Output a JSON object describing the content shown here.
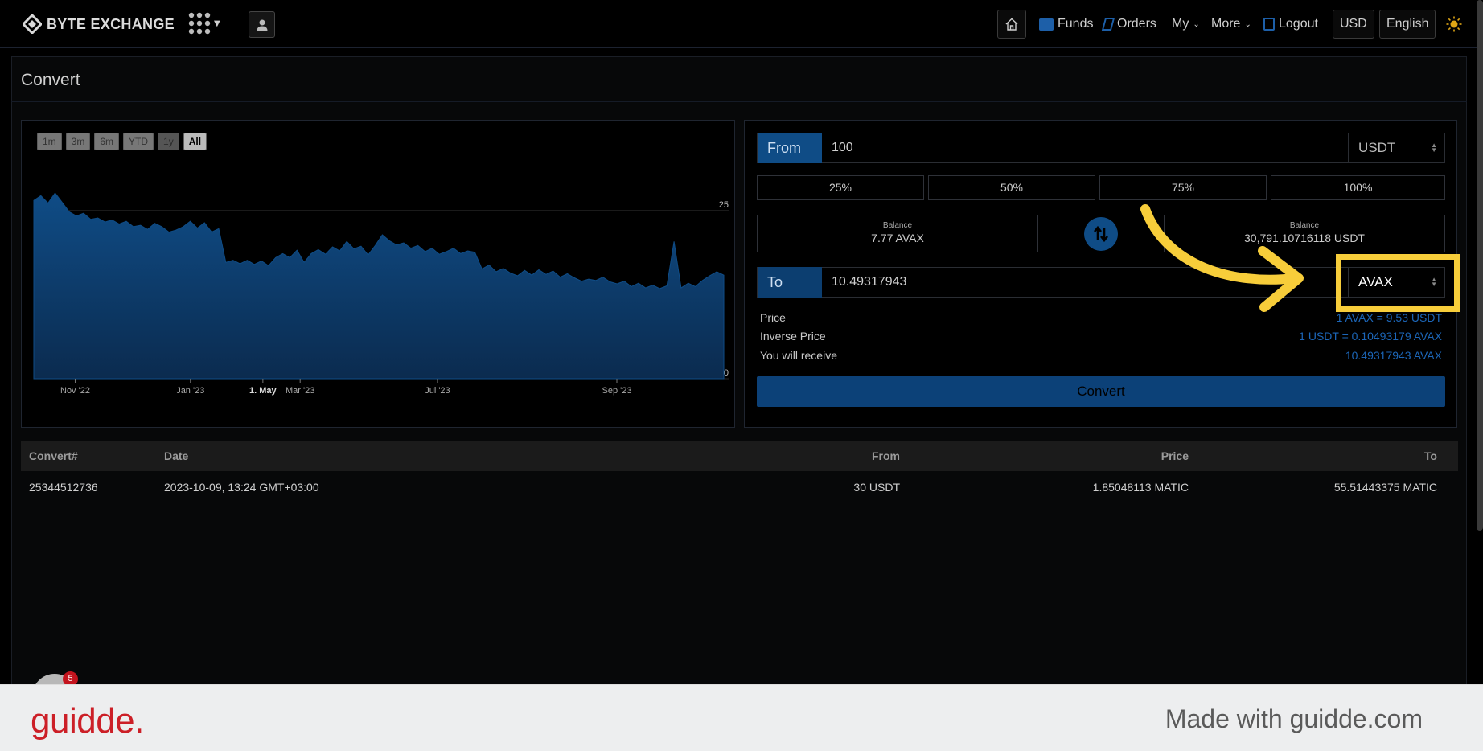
{
  "brand": {
    "name": "BYTE EXCHANGE"
  },
  "nav": {
    "funds": "Funds",
    "orders": "Orders",
    "my": "My",
    "more": "More",
    "logout": "Logout",
    "currency": "USD",
    "language": "English"
  },
  "page": {
    "title": "Convert"
  },
  "chart": {
    "range_buttons": [
      "1m",
      "3m",
      "6m",
      "YTD",
      "1y",
      "All"
    ],
    "active_range": "All",
    "disabled_range": "1y"
  },
  "chart_data": {
    "type": "area",
    "title": "",
    "xlabel": "",
    "ylabel": "",
    "ylim": [
      0,
      30
    ],
    "y_ticks": [
      0,
      25
    ],
    "x_tick_labels": [
      "Nov '22",
      "Jan '23",
      "1. May",
      "Mar '23",
      "Jul '23",
      "Sep '23"
    ],
    "color": "#0f4c86",
    "series": [
      {
        "values": [
          26.5,
          27.2,
          26.1,
          27.6,
          26.2,
          24.8,
          24.2,
          24.6,
          23.7,
          23.9,
          23.3,
          23.6,
          23.0,
          23.4,
          22.6,
          22.8,
          22.2,
          23.1,
          22.6,
          21.8,
          22.1,
          22.6,
          23.4,
          22.4,
          23.2,
          21.8,
          22.3,
          17.3,
          17.6,
          17.1,
          17.6,
          17.0,
          17.5,
          16.8,
          18.0,
          18.6,
          18.0,
          19.1,
          17.3,
          18.6,
          19.2,
          18.5,
          19.6,
          19.0,
          20.4,
          19.3,
          19.7,
          18.4,
          19.8,
          21.4,
          20.5,
          19.9,
          20.2,
          19.4,
          19.8,
          18.9,
          19.4,
          18.5,
          18.9,
          19.4,
          18.6,
          19.0,
          18.8,
          16.3,
          16.9,
          15.9,
          16.4,
          15.7,
          15.3,
          16.1,
          15.4,
          16.2,
          15.5,
          16.0,
          15.1,
          15.6,
          15.0,
          14.5,
          14.8,
          14.6,
          15.1,
          14.4,
          14.1,
          14.5,
          13.7,
          14.2,
          13.5,
          13.9,
          13.4,
          13.8,
          20.4,
          13.5,
          14.2,
          13.7,
          14.6,
          15.3,
          15.9,
          15.4
        ]
      }
    ]
  },
  "convert": {
    "from": {
      "label": "From",
      "amount": "100",
      "currency": "USDT"
    },
    "percent_buttons": [
      "25%",
      "50%",
      "75%",
      "100%"
    ],
    "balance_left": {
      "label": "Balance",
      "value": "7.77 AVAX"
    },
    "balance_right": {
      "label": "Balance",
      "value": "30,791.10716118 USDT"
    },
    "to": {
      "label": "To",
      "amount": "10.49317943",
      "currency": "AVAX"
    },
    "price": {
      "label": "Price",
      "value": "1 AVAX = 9.53 USDT"
    },
    "inverse_price": {
      "label": "Inverse Price",
      "value": "1 USDT = 0.10493179 AVAX"
    },
    "receive": {
      "label": "You will receive",
      "value": "10.49317943 AVAX"
    },
    "button": "Convert"
  },
  "table": {
    "headers": [
      "Convert#",
      "Date",
      "From",
      "Price",
      "To"
    ],
    "rows": [
      [
        "25344512736",
        "2023-10-09, 13:24 GMT+03:00",
        "30 USDT",
        "1.85048113 MATIC",
        "55.51443375 MATIC"
      ]
    ]
  },
  "widget": {
    "badge": "5"
  },
  "footer": {
    "logo": "guidde.",
    "text": "Made with guidde.com"
  },
  "colors": {
    "accent": "#0f4c86",
    "highlight": "#f7cd3a",
    "link": "#1c66b8",
    "footer_logo": "#cc1f27"
  }
}
